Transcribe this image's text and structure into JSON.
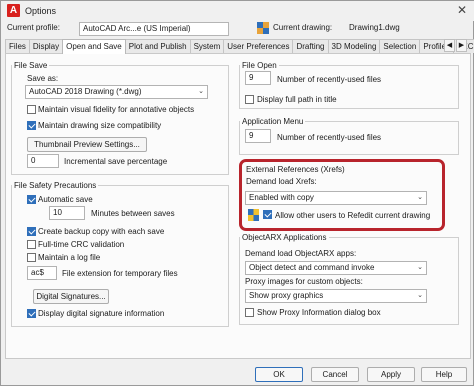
{
  "window": {
    "title": "Options"
  },
  "info": {
    "profile_label": "Current profile:",
    "profile_value": "AutoCAD Arc...e (US Imperial)",
    "drawing_label": "Current drawing:",
    "drawing_value": "Drawing1.dwg"
  },
  "tabs": [
    {
      "label": "Files",
      "active": false
    },
    {
      "label": "Display",
      "active": false
    },
    {
      "label": "Open and Save",
      "active": true
    },
    {
      "label": "Plot and Publish",
      "active": false
    },
    {
      "label": "System",
      "active": false
    },
    {
      "label": "User Preferences",
      "active": false
    },
    {
      "label": "Drafting",
      "active": false
    },
    {
      "label": "3D Modeling",
      "active": false
    },
    {
      "label": "Selection",
      "active": false
    },
    {
      "label": "Profiles",
      "active": false
    },
    {
      "label": "AEC E",
      "active": false
    }
  ],
  "file_save": {
    "title": "File Save",
    "save_as_label": "Save as:",
    "save_as_value": "AutoCAD 2018 Drawing (*.dwg)",
    "maintain_visual_fidelity": "Maintain visual fidelity for annotative objects",
    "maintain_visual_fidelity_checked": false,
    "maintain_drawing_size": "Maintain drawing size compatibility",
    "maintain_drawing_size_checked": true,
    "thumbnail_button": "Thumbnail Preview Settings...",
    "incremental_value": "0",
    "incremental_label": "Incremental save percentage"
  },
  "file_safety": {
    "title": "File Safety Precautions",
    "automatic_save": "Automatic save",
    "automatic_save_checked": true,
    "minutes_value": "10",
    "minutes_label": "Minutes between saves",
    "backup_copy": "Create backup copy with each save",
    "backup_copy_checked": true,
    "crc_validation": "Full-time CRC validation",
    "crc_validation_checked": false,
    "log_file": "Maintain a log file",
    "log_file_checked": false,
    "temp_ext_value": "ac$",
    "temp_ext_label": "File extension for temporary files",
    "digital_signatures_button": "Digital Signatures...",
    "display_signature": "Display digital signature information",
    "display_signature_checked": true
  },
  "file_open": {
    "title": "File Open",
    "recent_value": "9",
    "recent_label": "Number of recently-used files",
    "full_path": "Display full path in title",
    "full_path_checked": false
  },
  "app_menu": {
    "title": "Application Menu",
    "recent_value": "9",
    "recent_label": "Number of recently-used files"
  },
  "xrefs": {
    "title": "External References (Xrefs)",
    "demand_load_label": "Demand load Xrefs:",
    "demand_load_value": "Enabled with copy",
    "allow_refedit": "Allow other users to Refedit current drawing",
    "allow_refedit_checked": true
  },
  "objectarx": {
    "title": "ObjectARX Applications",
    "demand_load_label": "Demand load ObjectARX apps:",
    "demand_load_value": "Object detect and command invoke",
    "proxy_label": "Proxy images for custom objects:",
    "proxy_value": "Show proxy graphics",
    "proxy_dialog": "Show Proxy Information dialog box",
    "proxy_dialog_checked": false
  },
  "footer": {
    "ok": "OK",
    "cancel": "Cancel",
    "apply": "Apply",
    "help": "Help"
  },
  "colors": {
    "accent": "#2f6fba",
    "highlight_border": "#b8242c",
    "brand": "#d8201d"
  }
}
